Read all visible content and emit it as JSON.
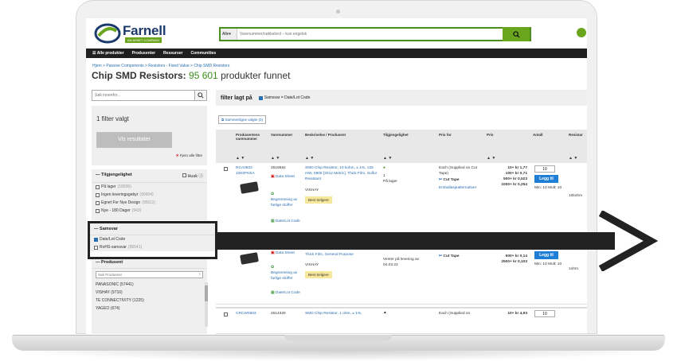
{
  "header": {
    "brand": "Farnell",
    "brand_sub": "AN AVNET COMPANY",
    "search_scope": "Alle",
    "search_placeholder": "Varenummer/nøkkelord – kun engelsk"
  },
  "nav": {
    "items": [
      "Alle produkter",
      "Produsenter",
      "Ressurser",
      "Communities"
    ]
  },
  "breadcrumb": "Hjem > Passive Components > Resistors - Fixed Value > Chip SMD Resistors",
  "title": {
    "main": "Chip SMD Resistors:",
    "count": "95 601",
    "suffix": "produkter funnet"
  },
  "sidebar": {
    "search_placeholder": "Søk innenfor...",
    "filter_count_text": "1 filter valgt",
    "show_results": "Vis resultater",
    "clear_all": "Fjern alle filtre",
    "availability": {
      "title": "Tilgjengelighet",
      "remember": "Husk",
      "options": [
        {
          "label": "På lager",
          "count": "(18936)"
        },
        {
          "label": "Ingen leveringsgebyr",
          "count": "(90004)"
        },
        {
          "label": "Egnet For Nye Design",
          "count": "(95511)"
        },
        {
          "label": "Nye - 180 Dager",
          "count": "(943)"
        }
      ]
    },
    "compliance": {
      "title": "Samsvar",
      "options": [
        {
          "label": "Date/Lot Code",
          "checked": true
        },
        {
          "label": "RoHS-samsvar",
          "count": "(95541)"
        }
      ]
    },
    "manufacturer": {
      "title": "Produsent",
      "search_placeholder": "Søk Produsent",
      "options": [
        "PANASONIC (57441)",
        "VISHAY (9716)",
        "TE CONNECTIVITY (1225)",
        "YAGEO (674)"
      ]
    }
  },
  "filter_bar": {
    "label": "filter lagt på",
    "chip": "Samsvar = Date/Lot Code"
  },
  "compare": "Sammenligne valgte (0)",
  "columns": [
    "Produsentens varenummer",
    "Varenummer",
    "Beskrivelse / Produsent",
    "Tilgjengelighet",
    "Pris for",
    "Pris",
    "Antall",
    "Resistar"
  ],
  "rows": [
    {
      "mpn": "RCA0603 10K0FKEA",
      "order_code": "2616592",
      "datasheet": "Data Sheet",
      "restricted": "Begrensning av farlige stoffer",
      "date_code": "Date/Lot Code",
      "description": "SMD Chip Resistor, 10 kohm, ± 1%, 125 mW, 0805 [2012 Metric], Thick Film, Sulfur Resistant",
      "maker": "VISHAY",
      "badge": "Best Selgere",
      "stock": "1",
      "stock_label": "På lager",
      "price_for": "Each (Supplied on Cut Tape)",
      "cut_tape": "Cut Tape",
      "packaging": "Emballasjealternativer",
      "prices": [
        "10+ kr 1,77",
        "100+ kr 0,71",
        "500+ kr 0,523",
        "1000+ kr 0,254"
      ],
      "qty": "10",
      "cart": "Legg til",
      "min": "Min: 10 Mult: 10",
      "resist": "10kohm"
    },
    {
      "datasheet": "Data Sheet",
      "restricted": "Begrensning av farlige stoffer",
      "date_code": "Date/Lot Code",
      "description": "Thick Film, General Purpose",
      "maker": "VISHAY",
      "badge": "Best Selgere",
      "stock_label": "Venter på levering av 04.03.22",
      "cut_tape": "Cut Tape",
      "prices": [
        "500+ kr 0,14",
        "2500+ kr 0,103"
      ],
      "cart": "Legg til",
      "min": "Min: 10 Mult: 10",
      "resist": "1ohm"
    },
    {
      "mpn": "CRCW0603",
      "order_code": "2614328",
      "description": "SMD Chip Resistor, 1 ohm, ± 1%,",
      "price_for": "Each (Supplied on",
      "prices": [
        "10+ kr 4,93"
      ],
      "qty": "10"
    }
  ],
  "colors": {
    "brand_green": "#6aa51e",
    "link_blue": "#2a6db0",
    "nav_dark": "#1f1f1f"
  }
}
